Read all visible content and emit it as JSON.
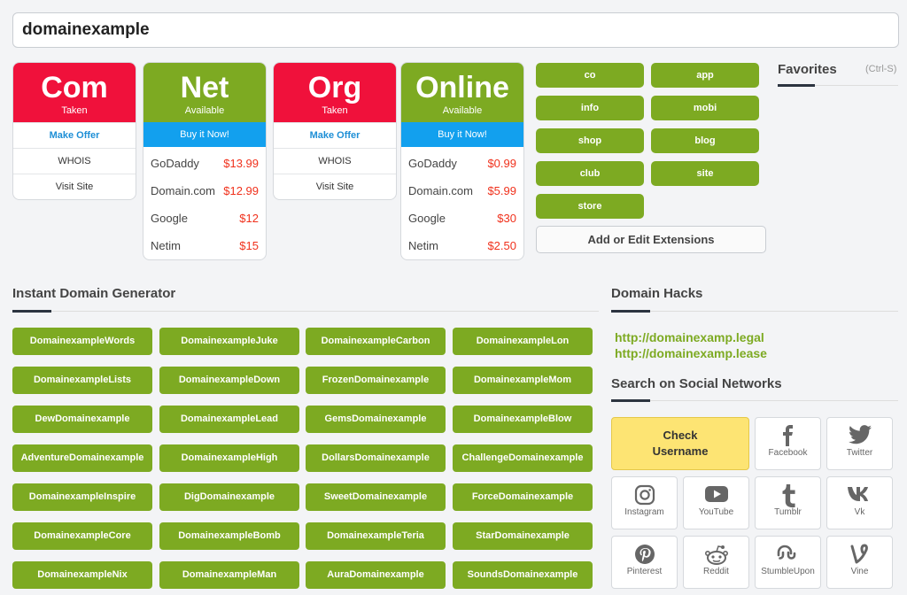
{
  "search": {
    "value": "domainexample"
  },
  "tlds": [
    {
      "name": "Com",
      "status": "Taken",
      "actions": [
        "Make Offer",
        "WHOIS",
        "Visit Site"
      ]
    },
    {
      "name": "Net",
      "status": "Available",
      "buy_label": "Buy it Now!",
      "prices": [
        {
          "registrar": "GoDaddy",
          "price": "$13.99"
        },
        {
          "registrar": "Domain.com",
          "price": "$12.99"
        },
        {
          "registrar": "Google",
          "price": "$12"
        },
        {
          "registrar": "Netim",
          "price": "$15"
        }
      ]
    },
    {
      "name": "Org",
      "status": "Taken",
      "actions": [
        "Make Offer",
        "WHOIS",
        "Visit Site"
      ]
    },
    {
      "name": "Online",
      "status": "Available",
      "buy_label": "Buy it Now!",
      "prices": [
        {
          "registrar": "GoDaddy",
          "price": "$0.99"
        },
        {
          "registrar": "Domain.com",
          "price": "$5.99"
        },
        {
          "registrar": "Google",
          "price": "$30"
        },
        {
          "registrar": "Netim",
          "price": "$2.50"
        }
      ]
    }
  ],
  "extensions": [
    "co",
    "app",
    "info",
    "mobi",
    "shop",
    "blog",
    "club",
    "site",
    "store"
  ],
  "edit_extensions_label": "Add or Edit Extensions",
  "favorites": {
    "title": "Favorites",
    "hint": "(Ctrl-S)"
  },
  "generator": {
    "title": "Instant Domain Generator",
    "names": [
      "DomainexampleWords",
      "DomainexampleJuke",
      "DomainexampleCarbon",
      "DomainexampleLon",
      "DomainexampleLists",
      "DomainexampleDown",
      "FrozenDomainexample",
      "DomainexampleMom",
      "DewDomainexample",
      "DomainexampleLead",
      "GemsDomainexample",
      "DomainexampleBlow",
      "AdventureDomainexample",
      "DomainexampleHigh",
      "DollarsDomainexample",
      "ChallengeDomainexample",
      "DomainexampleInspire",
      "DigDomainexample",
      "SweetDomainexample",
      "ForceDomainexample",
      "DomainexampleCore",
      "DomainexampleBomb",
      "DomainexampleTeria",
      "StarDomainexample",
      "DomainexampleNix",
      "DomainexampleMan",
      "AuraDomainexample",
      "SoundsDomainexample"
    ]
  },
  "hacks": {
    "title": "Domain Hacks",
    "links": [
      "http://domainexamp.legal",
      "http://domainexamp.lease"
    ]
  },
  "social": {
    "title": "Search on Social Networks",
    "check_label": "Check Username",
    "networks": [
      {
        "label": "Facebook",
        "icon": "facebook-icon"
      },
      {
        "label": "Twitter",
        "icon": "twitter-icon"
      },
      {
        "label": "Instagram",
        "icon": "instagram-icon"
      },
      {
        "label": "YouTube",
        "icon": "youtube-icon"
      },
      {
        "label": "Tumblr",
        "icon": "tumblr-icon"
      },
      {
        "label": "Vk",
        "icon": "vk-icon"
      },
      {
        "label": "Pinterest",
        "icon": "pinterest-icon"
      },
      {
        "label": "Reddit",
        "icon": "reddit-icon"
      },
      {
        "label": "StumbleUpon",
        "icon": "stumbleupon-icon"
      },
      {
        "label": "Vine",
        "icon": "vine-icon"
      }
    ]
  },
  "colors": {
    "taken": "#f0113b",
    "available": "#7daa22",
    "buy": "#12a0ee",
    "price": "#f0311c",
    "check": "#fde473"
  }
}
